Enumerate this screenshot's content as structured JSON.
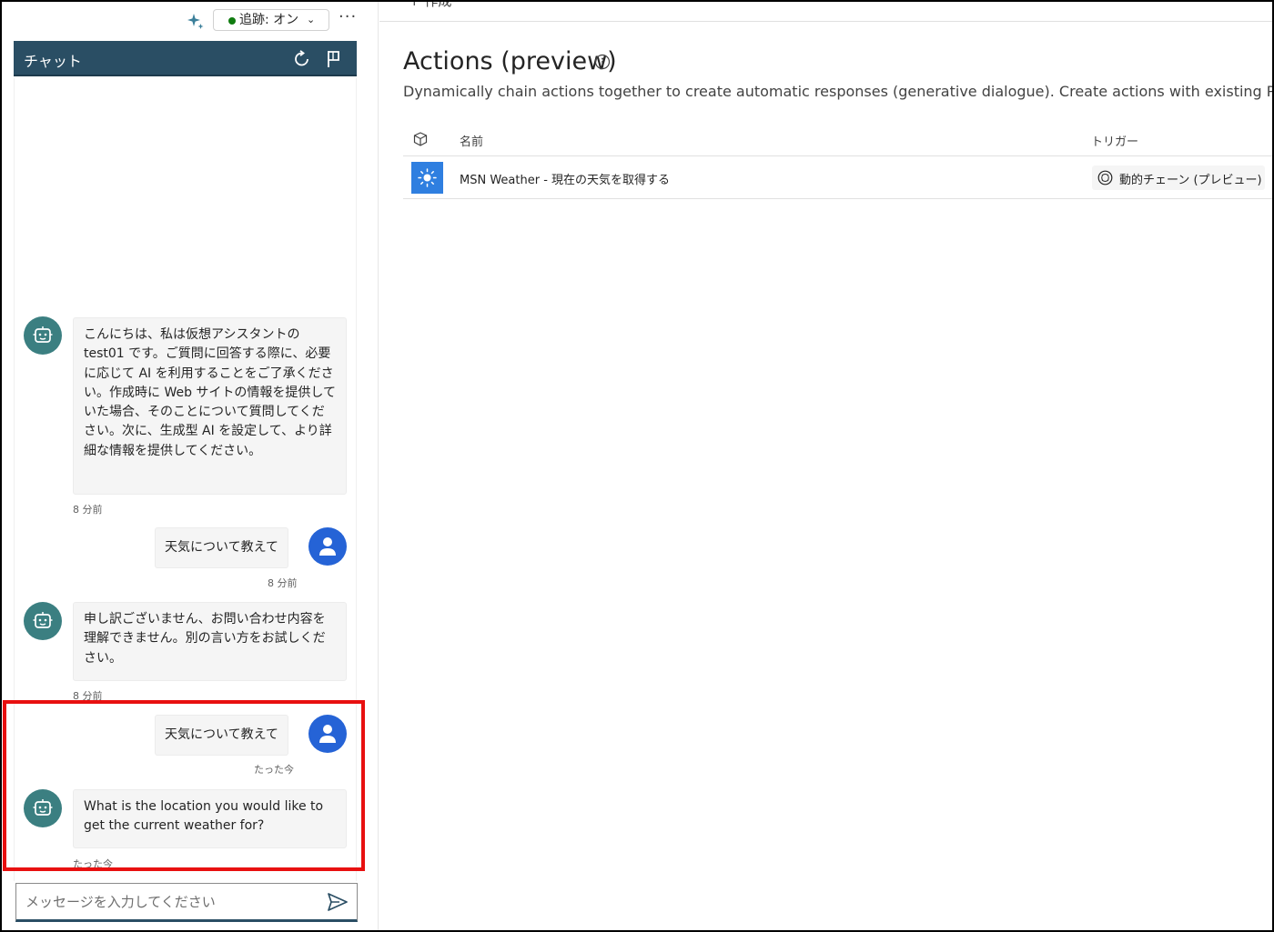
{
  "toolbar": {
    "tracking_label": "追跡: オン",
    "more_label": "···"
  },
  "chat": {
    "title": "チャット",
    "messages": [
      {
        "role": "bot",
        "text": "こんにちは、私は仮想アシスタントの test01 です。ご質問に回答する際に、必要に応じて AI を利用することをご了承ください。作成時に Web サイトの情報を提供していた場合、そのことについて質問してください。次に、生成型 AI を設定して、より詳細な情報を提供してください。",
        "time": "8 分前"
      },
      {
        "role": "user",
        "text": "天気について教えて",
        "time": "8 分前"
      },
      {
        "role": "bot",
        "text": "申し訳ございません、お問い合わせ内容を理解できません。別の言い方をお試しください。",
        "time": "8 分前"
      },
      {
        "role": "user",
        "text": "天気について教えて",
        "time": "たった今"
      },
      {
        "role": "bot",
        "text": "What is the location you would like to get the current weather for?",
        "time": "たった今"
      }
    ],
    "composer_placeholder": "メッセージを入力してください"
  },
  "content": {
    "create_label": "+ 作成",
    "title": "Actions (preview)",
    "description": "Dynamically chain actions together to create automatic responses (generative dialogue). Create actions with existing Power Pla",
    "table": {
      "col_name": "名前",
      "col_trigger": "トリガー",
      "rows": [
        {
          "name": "MSN Weather - 現在の天気を取得する",
          "trigger": "動的チェーン (プレビュー)"
        }
      ]
    }
  },
  "colors": {
    "chat_header": "#2a4e64",
    "bot_avatar": "#3b7f81",
    "user_avatar": "#2563d6",
    "highlight": "#e81010",
    "weather_tile": "#2f7fe0",
    "tracking_dot": "#107c10"
  },
  "icons": {
    "sparkle": "sparkle-icon",
    "refresh": "refresh-icon",
    "flag": "flag-icon",
    "bot": "bot-icon",
    "user": "person-icon",
    "send": "send-icon",
    "info": "info-icon",
    "cube": "cube-icon",
    "sun": "sun-icon",
    "trigger": "chain-icon"
  }
}
